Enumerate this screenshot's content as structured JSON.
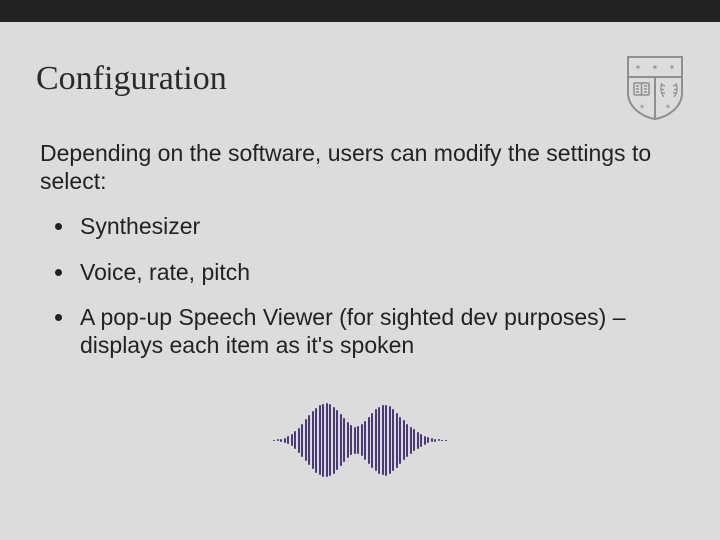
{
  "title": "Configuration",
  "intro": "Depending on the software, users can modify the settings to select:",
  "bullets": [
    "Synthesizer",
    "Voice, rate, pitch",
    "A pop-up Speech Viewer (for sighted dev purposes) – displays each item as it's spoken"
  ],
  "shield_color": "#8f8f8f",
  "wave_color": "#4b3a78",
  "wave_bars": [
    1,
    2,
    3,
    5,
    8,
    12,
    18,
    25,
    33,
    42,
    50,
    58,
    65,
    70,
    73,
    74,
    72,
    67,
    60,
    52,
    44,
    36,
    30,
    27,
    28,
    32,
    39,
    47,
    55,
    62,
    67,
    70,
    71,
    68,
    62,
    55,
    47,
    40,
    33,
    27,
    22,
    17,
    13,
    9,
    6,
    4,
    3,
    2,
    1,
    1
  ]
}
